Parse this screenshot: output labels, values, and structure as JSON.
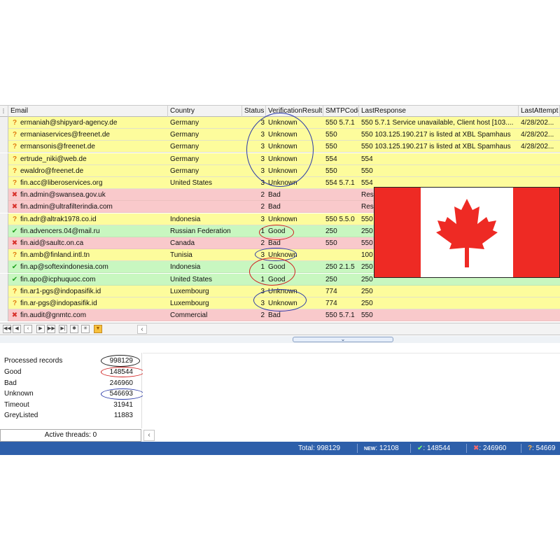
{
  "columns": {
    "email": "Email",
    "country": "Country",
    "status": "Status",
    "verification": "VerificationResult",
    "smtp": "SMTPCode",
    "response": "LastResponse",
    "attempt": "LastAttempt"
  },
  "rows": [
    {
      "email": "ermaniah@shipyard-agency.de",
      "country": "Germany",
      "status": "3",
      "result": "Unknown",
      "smtp": "550 5.7.1",
      "response": "550 5.7.1 Service unavailable, Client host [103....",
      "attempt": "4/28/202..."
    },
    {
      "email": "ermaniaservices@freenet.de",
      "country": "Germany",
      "status": "3",
      "result": "Unknown",
      "smtp": "550",
      "response": "550 103.125.190.217 is listed at XBL Spamhaus",
      "attempt": "4/28/202..."
    },
    {
      "email": "ermansonis@freenet.de",
      "country": "Germany",
      "status": "3",
      "result": "Unknown",
      "smtp": "550",
      "response": "550 103.125.190.217 is listed at XBL Spamhaus",
      "attempt": "4/28/202..."
    },
    {
      "email": "ertrude_niki@web.de",
      "country": "Germany",
      "status": "3",
      "result": "Unknown",
      "smtp": "554",
      "response": "554",
      "attempt": ""
    },
    {
      "email": "ewaldro@freenet.de",
      "country": "Germany",
      "status": "3",
      "result": "Unknown",
      "smtp": "550",
      "response": "550",
      "attempt": ""
    },
    {
      "email": "fin.acc@liberoservices.org",
      "country": "United States",
      "status": "3",
      "result": "Unknown",
      "smtp": "554 5.7.1",
      "response": "554",
      "attempt": ""
    },
    {
      "email": "fin.admin@swansea.gov.uk",
      "country": "",
      "status": "2",
      "result": "Bad",
      "smtp": "",
      "response": "Res",
      "attempt": ""
    },
    {
      "email": "fin.admin@ultrafilterindia.com",
      "country": "",
      "status": "2",
      "result": "Bad",
      "smtp": "",
      "response": "Res",
      "attempt": ""
    },
    {
      "email": "fin.adr@altrak1978.co.id",
      "country": "Indonesia",
      "status": "3",
      "result": "Unknown",
      "smtp": "550 5.5.0",
      "response": "550",
      "attempt": ""
    },
    {
      "email": "fin.advencers.04@mail.ru",
      "country": "Russian Federation",
      "status": "1",
      "result": "Good",
      "smtp": "250",
      "response": "250",
      "attempt": ""
    },
    {
      "email": "fin.aid@saultc.on.ca",
      "country": "Canada",
      "status": "2",
      "result": "Bad",
      "smtp": "550",
      "response": "550",
      "attempt": ""
    },
    {
      "email": "fin.amb@finland.intl.tn",
      "country": "Tunisia",
      "status": "3",
      "result": "Unknown",
      "smtp": "",
      "response": "100",
      "attempt": ""
    },
    {
      "email": "fin.ap@softexindonesia.com",
      "country": "Indonesia",
      "status": "1",
      "result": "Good",
      "smtp": "250 2.1.5",
      "response": "250",
      "attempt": ""
    },
    {
      "email": "fin.apo@icphuquoc.com",
      "country": "United States",
      "status": "1",
      "result": "Good",
      "smtp": "250",
      "response": "250",
      "attempt": ""
    },
    {
      "email": "fin.ar1-pgs@indopasifik.id",
      "country": "Luxembourg",
      "status": "3",
      "result": "Unknown",
      "smtp": "774",
      "response": "250",
      "attempt": ""
    },
    {
      "email": "fin.ar-pgs@indopasifik.id",
      "country": "Luxembourg",
      "status": "3",
      "result": "Unknown",
      "smtp": "774",
      "response": "250",
      "attempt": ""
    },
    {
      "email": "fin.audit@gnmtc.com",
      "country": "Commercial",
      "status": "2",
      "result": "Bad",
      "smtp": "550 5.7.1",
      "response": "550",
      "attempt": ""
    }
  ],
  "stats": {
    "processed_label": "Processed records",
    "processed": "998129",
    "good_label": "Good",
    "good": "148544",
    "bad_label": "Bad",
    "bad": "246960",
    "unknown_label": "Unknown",
    "unknown": "546693",
    "timeout_label": "Timeout",
    "timeout": "31941",
    "greylisted_label": "GreyListed",
    "greylisted": "11883"
  },
  "threads": "Active threads: 0",
  "statusbar": {
    "total": "Total: 998129",
    "new_tag": "NEW",
    "new": ": 12108",
    "good": ": 148544",
    "bad": ": 246960",
    "unknown": ": 54669"
  },
  "colors": {
    "unknown_row": "#fdfc9c",
    "bad_row": "#f9c9cb",
    "good_row": "#c8f7c0",
    "statusbar": "#2d5faa",
    "flag_red": "#ee2a24"
  }
}
